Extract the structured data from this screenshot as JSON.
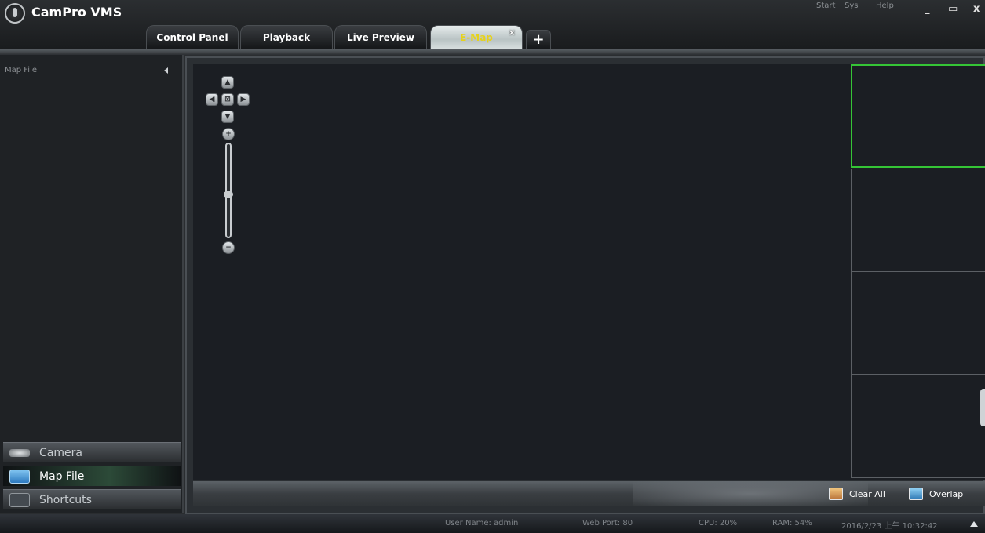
{
  "app": {
    "title": "CamPro VMS"
  },
  "tabs": [
    {
      "label": "Control Panel"
    },
    {
      "label": "Playback"
    },
    {
      "label": "Live Preview"
    },
    {
      "label": "E-Map",
      "active": true,
      "close": "×"
    }
  ],
  "tab_add": "+",
  "sys_menu": {
    "start": "Start",
    "sys": "Sys",
    "help": "Help"
  },
  "window_controls": {
    "minimize": "_",
    "maximize": "▭",
    "close": "x"
  },
  "left_panel": {
    "header": "Map File",
    "nav": [
      {
        "label": "Camera",
        "icon": "camera-icon"
      },
      {
        "label": "Map File",
        "icon": "map-file-icon",
        "active": true
      },
      {
        "label": "Shortcuts",
        "icon": "shortcuts-icon"
      }
    ]
  },
  "ptz": {
    "up": "▲",
    "left": "◀",
    "center": "⊠",
    "right": "▶",
    "down": "▼",
    "zoom_in": "+",
    "zoom_out": "−"
  },
  "toolbar": {
    "clear_all": "Clear All",
    "overlap": "Overlap"
  },
  "status": {
    "user": "User Name: admin",
    "web_port": "Web Port: 80",
    "cpu": "CPU: 20%",
    "ram": "RAM: 54%",
    "datetime": "2016/2/23 上午 10:32:42"
  },
  "colors": {
    "selected_pane": "#35c536",
    "active_tab_text": "#e6d21b"
  }
}
